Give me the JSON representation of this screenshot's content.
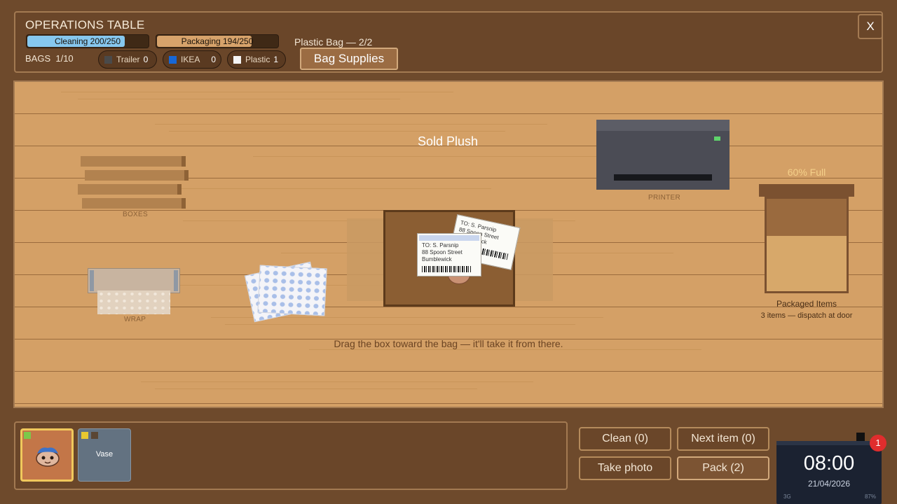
{
  "header": {
    "title": "OPERATIONS TABLE",
    "cleaning": {
      "label": "Cleaning 200/250",
      "value": 200,
      "max": 250,
      "color": "#86c7ee"
    },
    "packaging": {
      "label": "Packaging 194/250",
      "value": 194,
      "max": 250,
      "color": "#d7a36b"
    },
    "plastic_bag": "Plastic Bag — 2/2",
    "bags_label": "BAGS",
    "bags_value": "1/10",
    "bag_types": [
      {
        "label": "Trailer",
        "count": "0",
        "color": "#4a4a4a"
      },
      {
        "label": "IKEA",
        "count": "0",
        "color": "#1767d6"
      },
      {
        "label": "Plastic",
        "count": "1",
        "color": "#f4f4f4"
      }
    ],
    "bag_supplies_label": "Bag Supplies",
    "close_label": "X"
  },
  "table": {
    "boxes_label": "BOXES",
    "wrap_label": "WRAP",
    "printer_label": "PRINTER",
    "sold_title": "Sold Plush",
    "hint": "Drag the box toward the bag — it'll take it from there.",
    "shipping_label": {
      "to": "TO: S. Parsnip",
      "street": "88 Spoon Street",
      "town": "Bumblewick"
    },
    "bin": {
      "percent_label": "60% Full",
      "fill_fraction": 0.6,
      "title": "Packaged Items",
      "subtitle": "3 items — dispatch at door"
    }
  },
  "inventory": {
    "items": [
      {
        "name": "plush",
        "tag_color": "#7cc84a",
        "selected": true
      },
      {
        "name": "vase",
        "label": "Vase",
        "tag_colors": [
          "#e8c830",
          "#5a4634"
        ],
        "selected": false
      }
    ]
  },
  "actions": {
    "clean": "Clean (0)",
    "next_item": "Next item (0)",
    "take_photo": "Take photo",
    "pack": "Pack (2)"
  },
  "phone": {
    "time": "08:00",
    "date": "21/04/2026",
    "signal": "3G",
    "battery": "87%",
    "notifications": "1"
  }
}
